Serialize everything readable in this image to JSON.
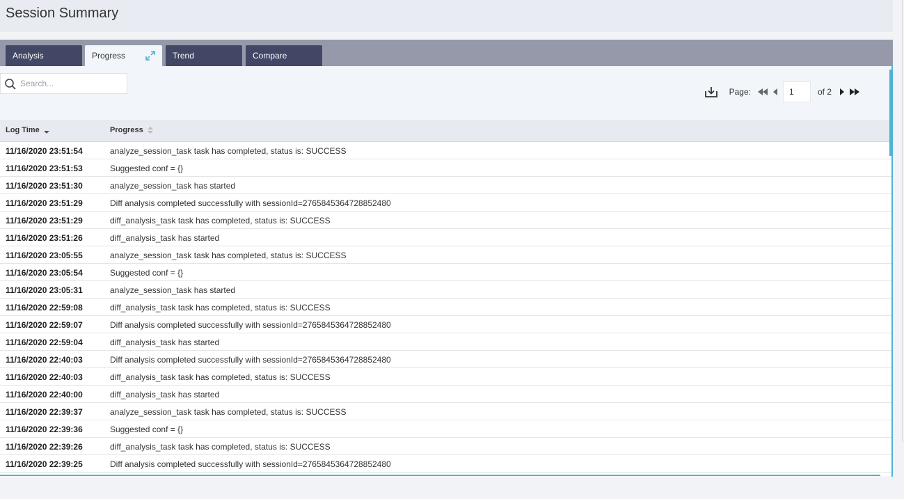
{
  "page": {
    "title": "Session Summary"
  },
  "tabs": [
    {
      "label": "Analysis",
      "active": false
    },
    {
      "label": "Progress",
      "active": true
    },
    {
      "label": "Trend",
      "active": false
    },
    {
      "label": "Compare",
      "active": false
    }
  ],
  "search": {
    "placeholder": "Search..."
  },
  "pager": {
    "label": "Page:",
    "current": "1",
    "of": "of 2"
  },
  "table": {
    "columns": [
      "Log Time",
      "Progress"
    ],
    "rows": [
      [
        "11/16/2020 23:51:54",
        "analyze_session_task task has completed, status is: SUCCESS"
      ],
      [
        "11/16/2020 23:51:53",
        "Suggested conf = {}"
      ],
      [
        "11/16/2020 23:51:30",
        "analyze_session_task has started"
      ],
      [
        "11/16/2020 23:51:29",
        "Diff analysis completed successfully with sessionId=2765845364728852480"
      ],
      [
        "11/16/2020 23:51:29",
        "diff_analysis_task task has completed, status is: SUCCESS"
      ],
      [
        "11/16/2020 23:51:26",
        "diff_analysis_task has started"
      ],
      [
        "11/16/2020 23:05:55",
        "analyze_session_task task has completed, status is: SUCCESS"
      ],
      [
        "11/16/2020 23:05:54",
        "Suggested conf = {}"
      ],
      [
        "11/16/2020 23:05:31",
        "analyze_session_task has started"
      ],
      [
        "11/16/2020 22:59:08",
        "diff_analysis_task task has completed, status is: SUCCESS"
      ],
      [
        "11/16/2020 22:59:07",
        "Diff analysis completed successfully with sessionId=2765845364728852480"
      ],
      [
        "11/16/2020 22:59:04",
        "diff_analysis_task has started"
      ],
      [
        "11/16/2020 22:40:03",
        "Diff analysis completed successfully with sessionId=2765845364728852480"
      ],
      [
        "11/16/2020 22:40:03",
        "diff_analysis_task task has completed, status is: SUCCESS"
      ],
      [
        "11/16/2020 22:40:00",
        "diff_analysis_task has started"
      ],
      [
        "11/16/2020 22:39:37",
        "analyze_session_task task has completed, status is: SUCCESS"
      ],
      [
        "11/16/2020 22:39:36",
        "Suggested conf = {}"
      ],
      [
        "11/16/2020 22:39:26",
        "diff_analysis_task task has completed, status is: SUCCESS"
      ],
      [
        "11/16/2020 22:39:25",
        "Diff analysis completed successfully with sessionId=2765845364728852480"
      ]
    ]
  },
  "icons": {
    "expand": "expand-icon",
    "search": "search-icon",
    "download": "download-icon",
    "first": "first-page-icon",
    "prev": "prev-page-icon",
    "next": "next-page-icon",
    "last": "last-page-icon",
    "sort": "sort-icon"
  },
  "colors": {
    "accent": "#4fb3d2",
    "tab_dark": "#424765",
    "tab_bar": "#9699a9"
  }
}
